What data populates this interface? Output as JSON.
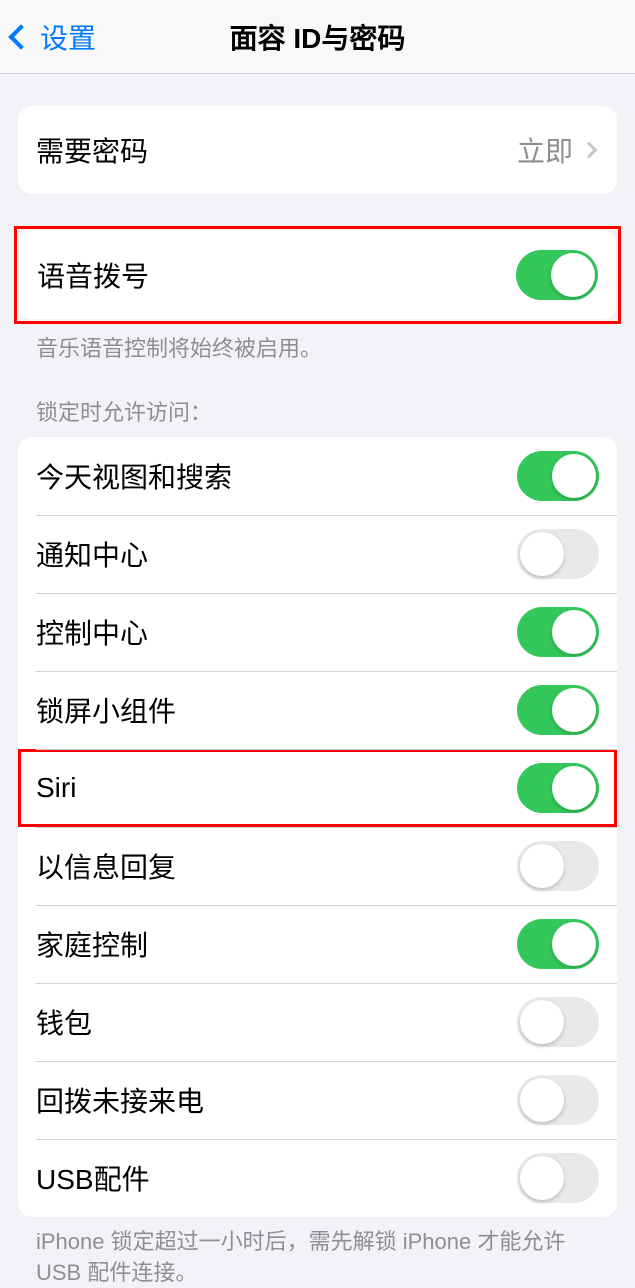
{
  "nav": {
    "back_label": "设置",
    "title": "面容 ID与密码"
  },
  "passcode_group": {
    "require_passcode": {
      "label": "需要密码",
      "value": "立即"
    }
  },
  "voice_group": {
    "voice_dial": {
      "label": "语音拨号",
      "on": true
    },
    "footer": "音乐语音控制将始终被启用。"
  },
  "locked_access": {
    "header": "锁定时允许访问：",
    "items": [
      {
        "label": "今天视图和搜索",
        "on": true,
        "name": "today-view-search",
        "highlight": false
      },
      {
        "label": "通知中心",
        "on": false,
        "name": "notification-center",
        "highlight": false
      },
      {
        "label": "控制中心",
        "on": true,
        "name": "control-center",
        "highlight": false
      },
      {
        "label": "锁屏小组件",
        "on": true,
        "name": "lock-screen-widgets",
        "highlight": false
      },
      {
        "label": "Siri",
        "on": true,
        "name": "siri",
        "highlight": true
      },
      {
        "label": "以信息回复",
        "on": false,
        "name": "reply-with-message",
        "highlight": false
      },
      {
        "label": "家庭控制",
        "on": true,
        "name": "home-control",
        "highlight": false
      },
      {
        "label": "钱包",
        "on": false,
        "name": "wallet",
        "highlight": false
      },
      {
        "label": "回拨未接来电",
        "on": false,
        "name": "return-missed-calls",
        "highlight": false
      },
      {
        "label": "USB配件",
        "on": false,
        "name": "usb-accessories",
        "highlight": false
      }
    ],
    "footer": "iPhone 锁定超过一小时后，需先解锁 iPhone 才能允许USB 配件连接。"
  }
}
